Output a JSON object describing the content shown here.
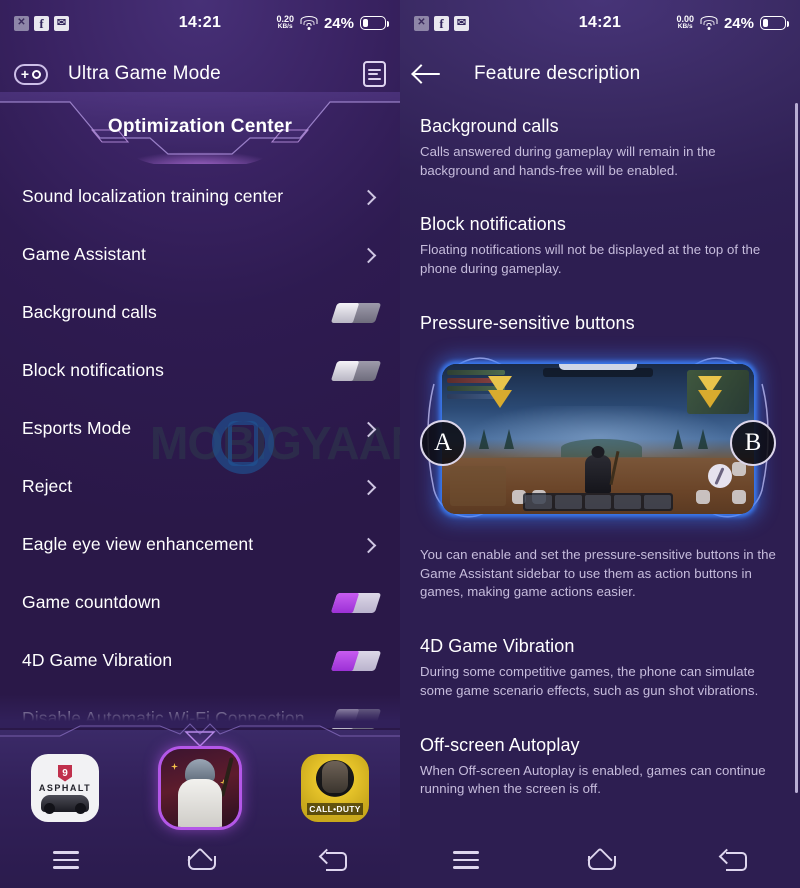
{
  "status_bar_left": {
    "app_icons": [
      "x-app-icon",
      "facebook-icon",
      "mail-icon"
    ],
    "time": "14:21",
    "net_speed_value": "0.20",
    "net_speed_unit": "KB/s",
    "battery_percent": "24%"
  },
  "status_bar_right": {
    "app_icons": [
      "x-app-icon",
      "facebook-icon",
      "mail-icon"
    ],
    "time": "14:21",
    "net_speed_value": "0.00",
    "net_speed_unit": "KB/s",
    "battery_percent": "24%"
  },
  "left_panel": {
    "appbar": {
      "leading_icon": "game-controller-icon",
      "title": "Ultra Game Mode",
      "trailing_icon": "document-list-icon"
    },
    "banner_title": "Optimization Center",
    "watermark_text": "MOBIGYAAN",
    "settings": [
      {
        "label": "Sound localization training center",
        "control": "chevron"
      },
      {
        "label": "Game Assistant",
        "control": "chevron"
      },
      {
        "label": "Background calls",
        "control": "toggle",
        "state": "off"
      },
      {
        "label": "Block notifications",
        "control": "toggle",
        "state": "off"
      },
      {
        "label": "Esports Mode",
        "control": "chevron"
      },
      {
        "label": "Reject",
        "control": "chevron"
      },
      {
        "label": "Eagle eye view enhancement",
        "control": "chevron"
      },
      {
        "label": "Game countdown",
        "control": "toggle",
        "state": "on"
      },
      {
        "label": "4D Game Vibration",
        "control": "toggle",
        "state": "on"
      },
      {
        "label": "Disable Automatic Wi-Fi Connection",
        "control": "toggle",
        "state": "off"
      }
    ],
    "dock_apps": [
      {
        "name": "Asphalt 9",
        "badge": "9",
        "word": "ASPHALT",
        "selected": false
      },
      {
        "name": "PUBG Mobile",
        "selected": true
      },
      {
        "name": "Call of Duty",
        "word": "CALL•DUTY",
        "selected": false
      }
    ]
  },
  "right_panel": {
    "appbar": {
      "leading_icon": "back-arrow-icon",
      "title": "Feature description"
    },
    "sections": [
      {
        "heading": "Background calls",
        "body": "Calls answered during gameplay will remain in the background and hands-free will be enabled."
      },
      {
        "heading": "Block notifications",
        "body": "Floating notifications will not be displayed at the top of the phone during gameplay."
      },
      {
        "heading": "Pressure-sensitive buttons",
        "body": "You can enable and set the pressure-sensitive buttons in the Game Assistant sidebar to use them as action buttons in games, making game actions easier.",
        "illustration": {
          "button_left_label": "A",
          "button_right_label": "B"
        }
      },
      {
        "heading": "4D Game Vibration",
        "body": "During some competitive games, the phone can simulate some game scenario effects, such as gun shot vibrations."
      },
      {
        "heading": "Off-screen Autoplay",
        "body": "When Off-screen Autoplay is enabled, games can continue running when the screen is off."
      }
    ]
  },
  "navbar": {
    "recent_label": "recent-apps",
    "home_label": "home",
    "back_label": "back"
  },
  "colors": {
    "accent_purple": "#b457e8",
    "bg_left": "#2c1a4e",
    "bg_right": "#2e1f52",
    "toggle_on": "#9c31d6",
    "body_text": "#c6bcdc"
  }
}
